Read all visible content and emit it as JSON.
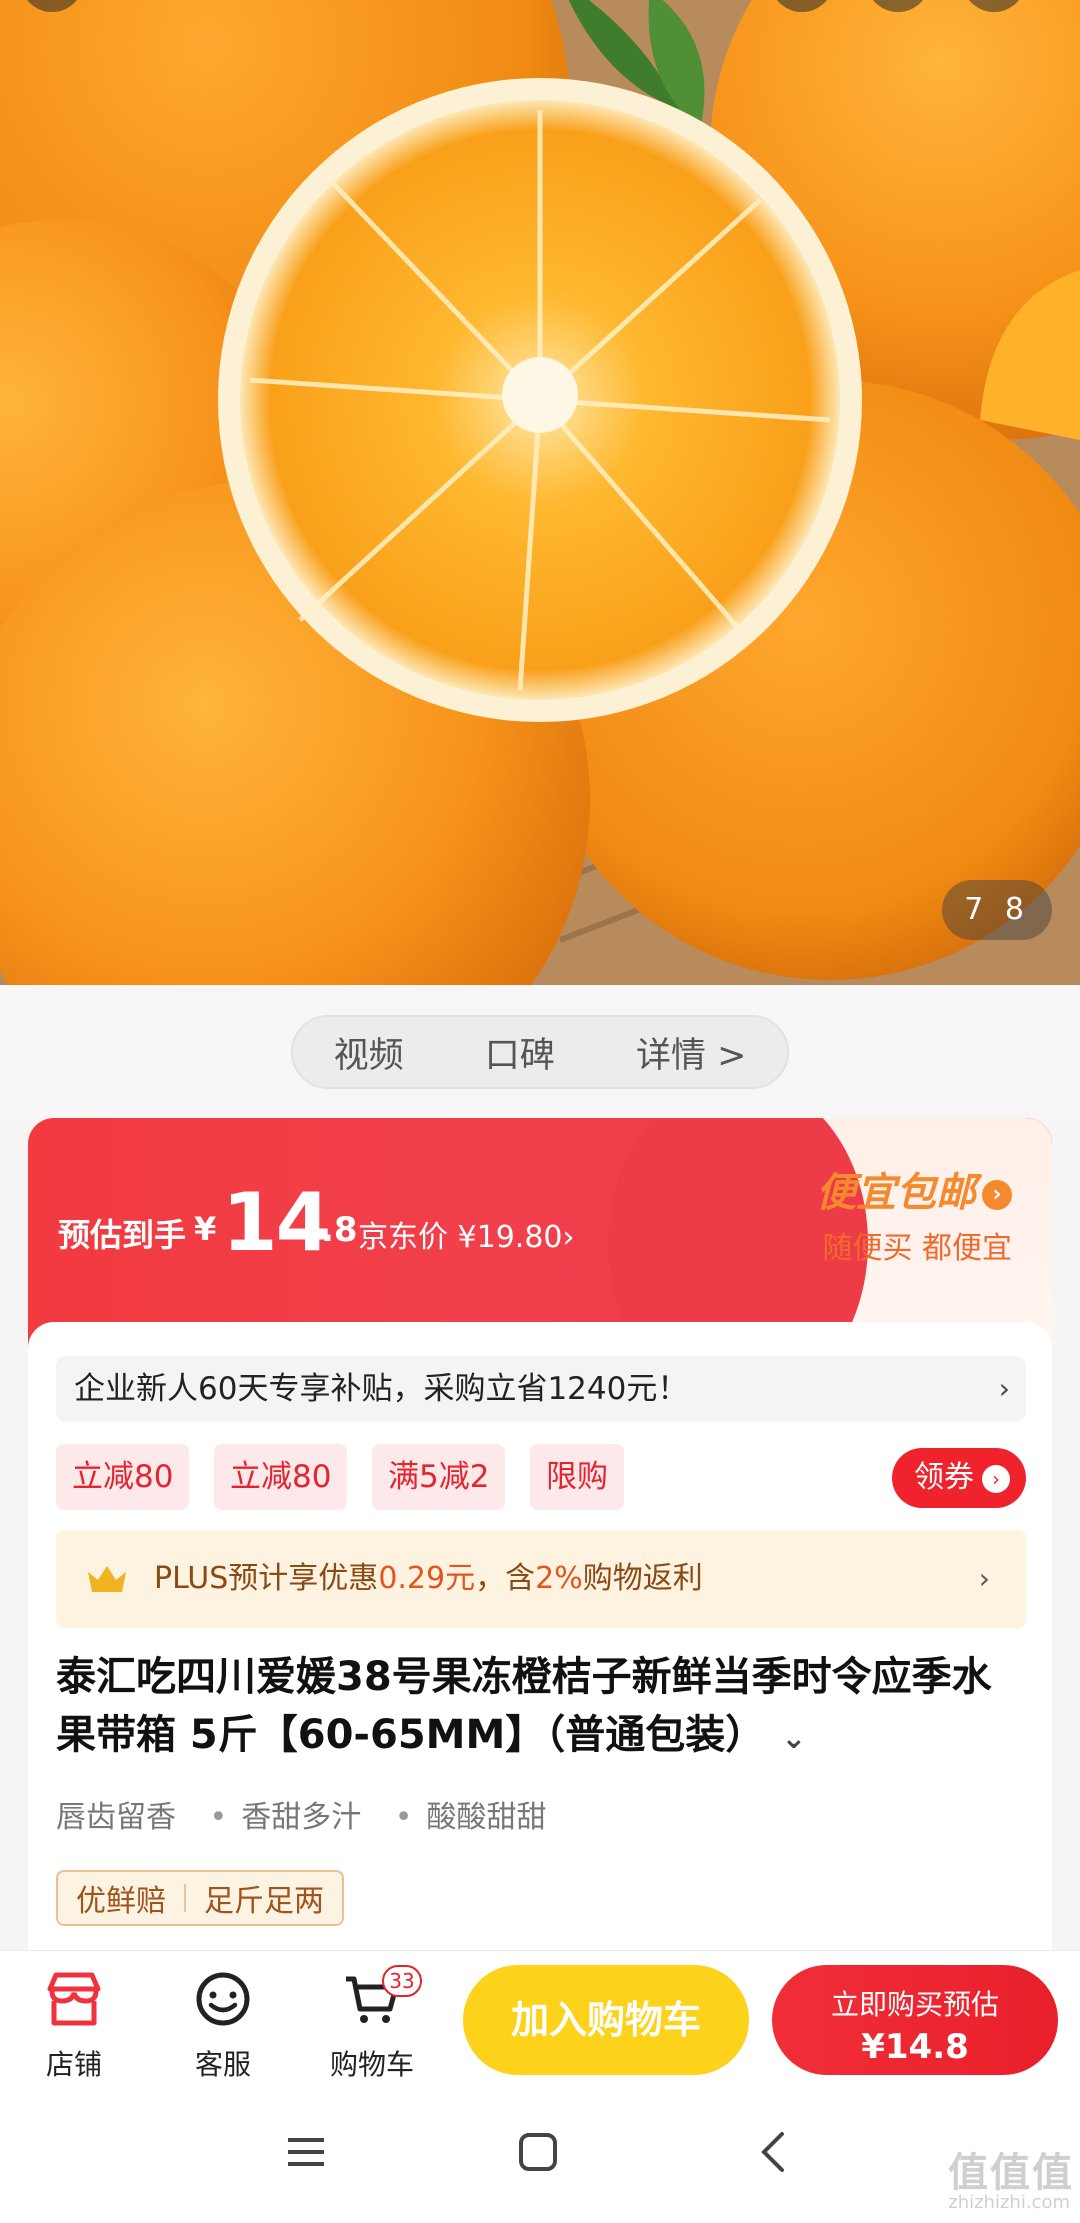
{
  "hero": {
    "image_label": "orange-product-photo",
    "counter": "7 8"
  },
  "tabs": [
    "视频",
    "口碑",
    "详情 >"
  ],
  "price": {
    "est_label": "预估到手",
    "currency": "¥",
    "integer": "14",
    "decimal": ".8",
    "jd_price": "京东价 ¥19.80›",
    "promo_title": "便宜包邮",
    "promo_arrow": "›",
    "promo_sub": "随便买 都便宜"
  },
  "subsidy": {
    "text": "企业新人60天专享补贴，采购立省1240元！",
    "chevron": "›"
  },
  "coupons": [
    "立减80",
    "立减80",
    "满5减2",
    "限购"
  ],
  "get_coupon": {
    "label": "领券",
    "arrow": "›"
  },
  "plus": {
    "prefix": "PLUS预计享优惠",
    "amount": "0.29元",
    "middle": "，含",
    "rate": "2%",
    "suffix": "购物返利",
    "chevron": "›"
  },
  "title": {
    "text": "泰汇吃四川爱媛38号果冻橙桔子新鲜当季时令应季水果带箱 5斤【60-65MM】（普通包装）",
    "chevron": "⌄"
  },
  "tags": [
    "唇齿留香",
    "香甜多汁",
    "酸酸甜甜"
  ],
  "badges": [
    "优鲜赔",
    "足斤足两"
  ],
  "actions": {
    "store": "店铺",
    "service": "客服",
    "cart": "购物车",
    "cart_count": "33",
    "add_cart": "加入购物车",
    "buy_line1": "立即购买预估",
    "buy_line2": "¥14.8"
  },
  "watermark": {
    "main": "值值值",
    "sub": "zhizhizhi.com"
  },
  "colors": {
    "accent_red": "#f0232c",
    "promo_orange": "#f5892d",
    "cart_yellow": "#fdd21b",
    "plus_brown": "#8a4a14"
  }
}
